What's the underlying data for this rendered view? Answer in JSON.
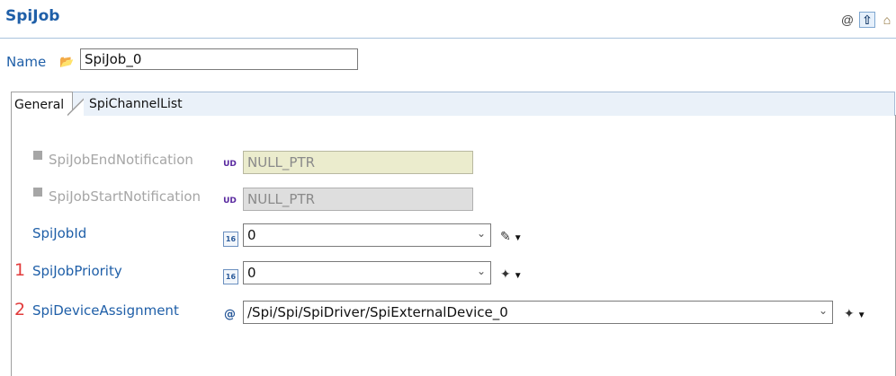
{
  "header": {
    "title": "SpiJob",
    "icons": [
      "at-icon",
      "up-arrow-icon",
      "home-icon"
    ]
  },
  "name_row": {
    "label": "Name",
    "value": "SpiJob_0"
  },
  "tabs": [
    {
      "label": "General",
      "active": true
    },
    {
      "label": "SpiChannelList",
      "active": false
    }
  ],
  "params": [
    {
      "label": "SpiJobEndNotification",
      "value": "NULL_PTR",
      "enabled": false
    },
    {
      "label": "SpiJobStartNotification",
      "value": "NULL_PTR",
      "enabled": false
    },
    {
      "label": "SpiJobId",
      "value": "0",
      "enabled": true
    },
    {
      "marker": "1",
      "label": "SpiJobPriority",
      "value": "0",
      "enabled": true
    },
    {
      "marker": "2",
      "label": "SpiDeviceAssignment",
      "value": "/Spi/Spi/SpiDriver/SpiExternalDevice_0",
      "enabled": true
    }
  ],
  "colors": {
    "accent": "#1f5fa8",
    "disabled_text": "#a6a6a6",
    "marker": "#e23b3b"
  }
}
